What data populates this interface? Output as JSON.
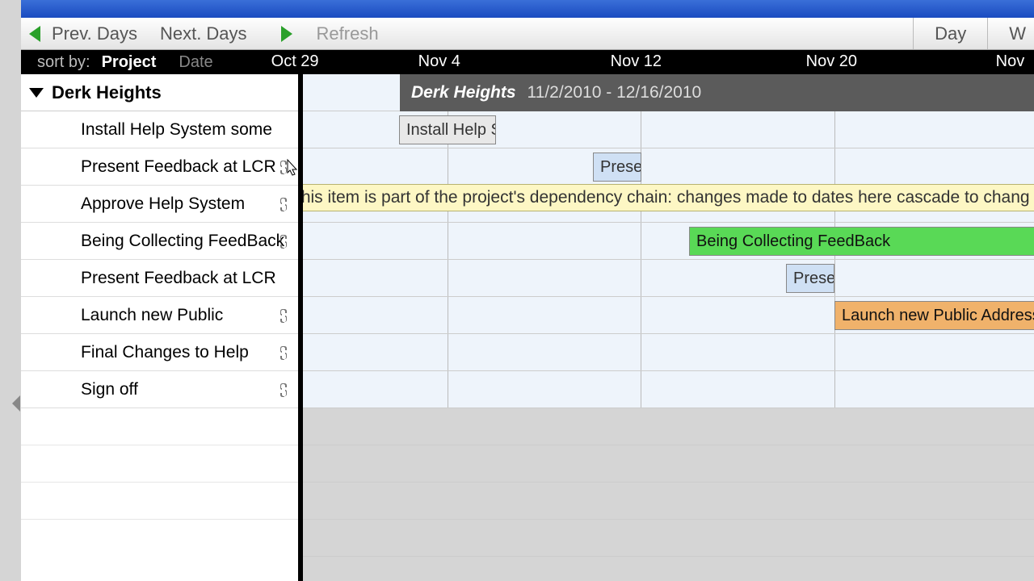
{
  "toolbar": {
    "prev": "Prev. Days",
    "next": "Next. Days",
    "refresh": "Refresh",
    "view_day": "Day",
    "view_week_partial": "W"
  },
  "header": {
    "sort_by": "sort by:",
    "sort_project": "Project",
    "sort_date": "Date",
    "dates": {
      "d1": "Oct 29",
      "d2": "Nov 4",
      "d3": "Nov 12",
      "d4": "Nov 20",
      "d5": "Nov"
    }
  },
  "project": {
    "name": "Derk Heights",
    "date_range": "11/2/2010 - 12/16/2010"
  },
  "tasks": [
    {
      "label": "Install Help System some",
      "has_link": false
    },
    {
      "label": "Present Feedback at LCR",
      "has_link": true
    },
    {
      "label": "Approve Help System",
      "has_link": true
    },
    {
      "label": "Being Collecting FeedBack",
      "has_link": true
    },
    {
      "label": "Present Feedback at LCR",
      "has_link": false
    },
    {
      "label": "Launch new Public",
      "has_link": true
    },
    {
      "label": "Final Changes to Help",
      "has_link": true
    },
    {
      "label": "Sign off",
      "has_link": true
    }
  ],
  "bars": {
    "install": "Install Help S",
    "present1": "Prese",
    "collecting": "Being Collecting FeedBack",
    "present2": "Prese",
    "launch": "Launch new Public Address S"
  },
  "tooltip": "This item is part of the project's dependency chain: changes made to dates here cascade to chang downstream items."
}
